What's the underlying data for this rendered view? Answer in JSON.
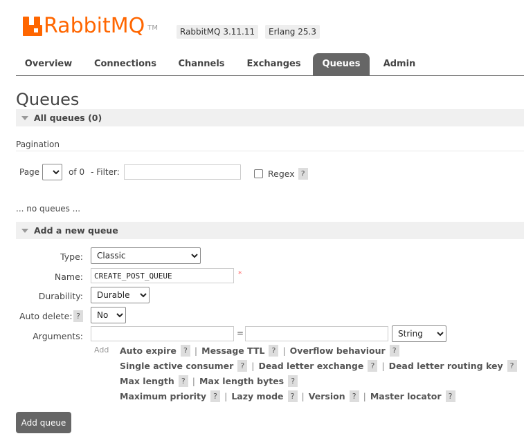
{
  "header": {
    "logo_text": "RabbitMQ",
    "logo_tm": "TM",
    "version_label": "RabbitMQ 3.11.11",
    "erlang_label": "Erlang 25.3",
    "brand_color": "#ff6600"
  },
  "tabs": [
    {
      "label": "Overview"
    },
    {
      "label": "Connections"
    },
    {
      "label": "Channels"
    },
    {
      "label": "Exchanges"
    },
    {
      "label": "Queues",
      "active": true
    },
    {
      "label": "Admin"
    }
  ],
  "page_title": "Queues",
  "all_queues": {
    "title": "All queues (0)",
    "pagination_title": "Pagination",
    "page_label": "Page",
    "of_label": "of 0",
    "filter_label": "- Filter:",
    "filter_value": "",
    "regex_label": "Regex",
    "help_glyph": "?",
    "empty_text": "... no queues ..."
  },
  "add_queue": {
    "title": "Add a new queue",
    "type_label": "Type:",
    "type_value": "Classic",
    "name_label": "Name:",
    "name_value": "CREATE_POST_QUEUE",
    "required_mark": "*",
    "durability_label": "Durability:",
    "durability_value": "Durable",
    "auto_delete_label": "Auto delete:",
    "auto_delete_value": "No",
    "arguments_label": "Arguments:",
    "arguments_equals": "=",
    "arguments_type_value": "String",
    "add_link": "Add",
    "argument_rows": [
      [
        "Auto expire",
        "Message TTL",
        "Overflow behaviour"
      ],
      [
        "Single active consumer",
        "Dead letter exchange",
        "Dead letter routing key"
      ],
      [
        "Max length",
        "Max length bytes"
      ],
      [
        "Maximum priority",
        "Lazy mode",
        "Version",
        "Master locator"
      ]
    ],
    "separator": "|",
    "submit_label": "Add queue"
  }
}
